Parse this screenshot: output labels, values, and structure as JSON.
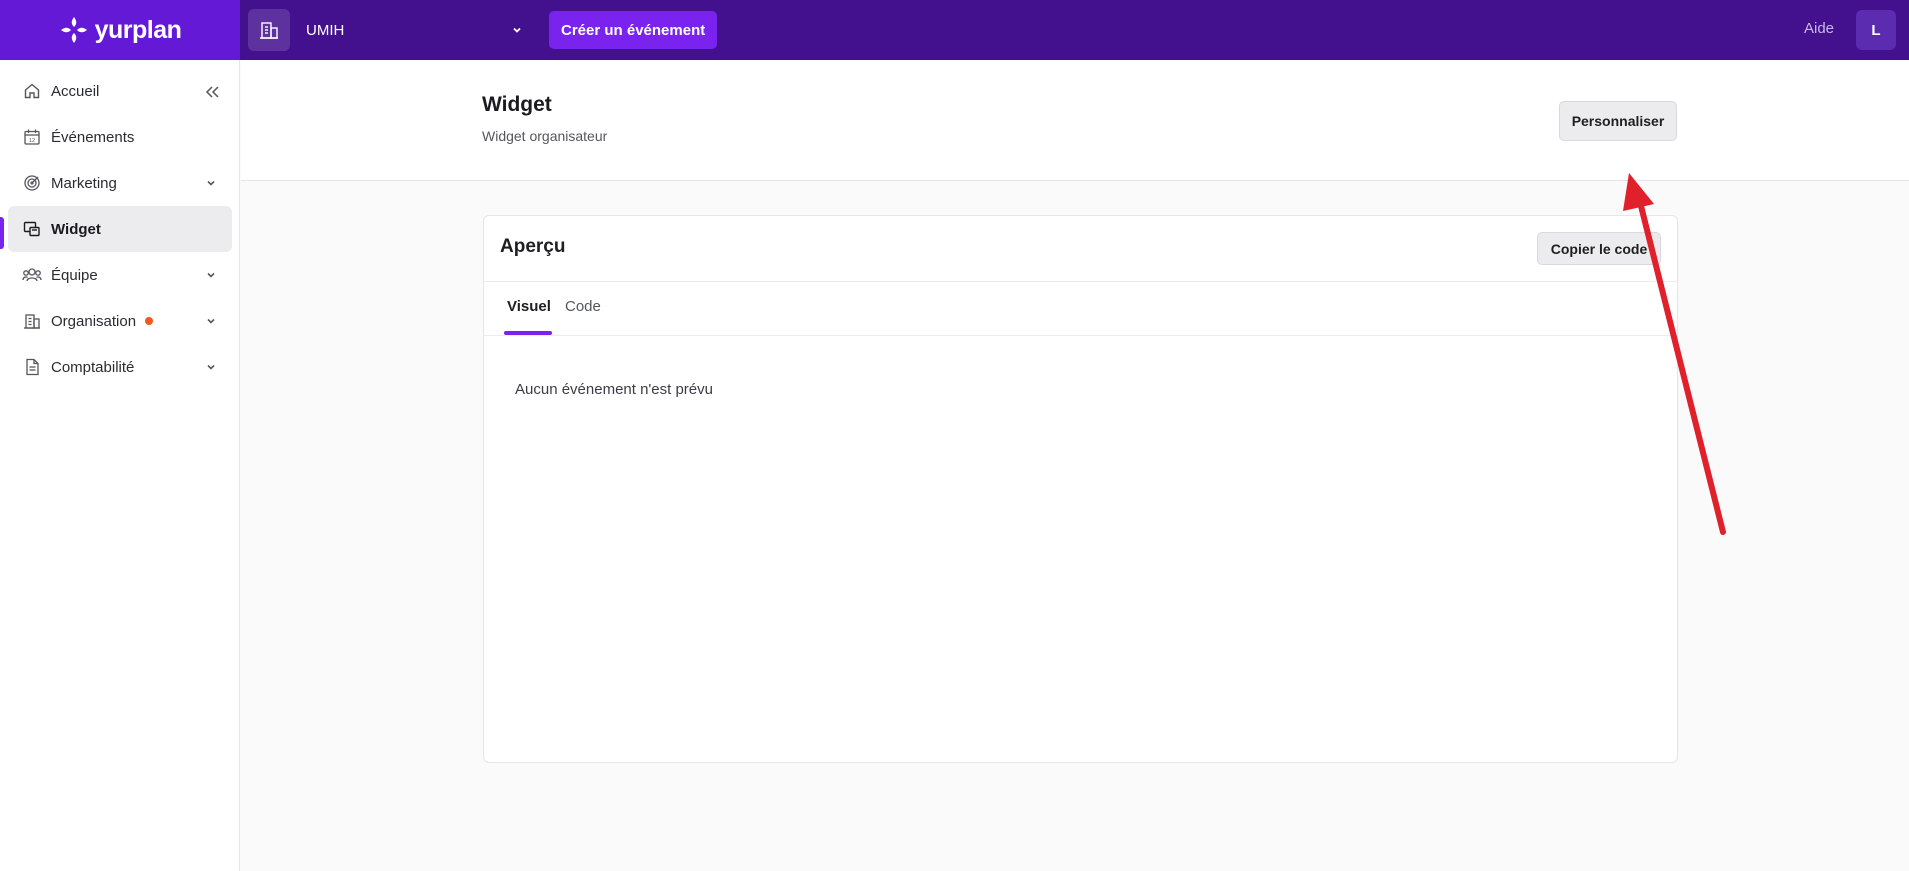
{
  "topbar": {
    "brand": "yurplan",
    "organization": "UMIH",
    "create_event_label": "Créer un événement",
    "help_label": "Aide",
    "avatar_initial": "L"
  },
  "sidebar": {
    "items": [
      {
        "label": "Accueil",
        "icon": "home-icon",
        "has_chevron": false
      },
      {
        "label": "Événements",
        "icon": "calendar-icon",
        "has_chevron": false
      },
      {
        "label": "Marketing",
        "icon": "target-icon",
        "has_chevron": true
      },
      {
        "label": "Widget",
        "icon": "widget-icon",
        "has_chevron": false,
        "active": true
      },
      {
        "label": "Équipe",
        "icon": "team-icon",
        "has_chevron": true
      },
      {
        "label": "Organisation",
        "icon": "building-icon",
        "has_chevron": true,
        "notification_dot": true
      },
      {
        "label": "Comptabilité",
        "icon": "document-icon",
        "has_chevron": true
      }
    ]
  },
  "header": {
    "title": "Widget",
    "subtitle": "Widget organisateur",
    "customize_label": "Personnaliser"
  },
  "preview": {
    "title": "Aperçu",
    "copy_code_label": "Copier le code",
    "tabs": [
      {
        "label": "Visuel",
        "active": true
      },
      {
        "label": "Code",
        "active": false
      }
    ],
    "empty_message": "Aucun événement n'est prévu"
  },
  "colors": {
    "topbar": "#43118e",
    "brand": "#6319d6",
    "accent": "#7a22ee",
    "notification_dot": "#f05a1c",
    "annotation_arrow": "#e0202a"
  }
}
